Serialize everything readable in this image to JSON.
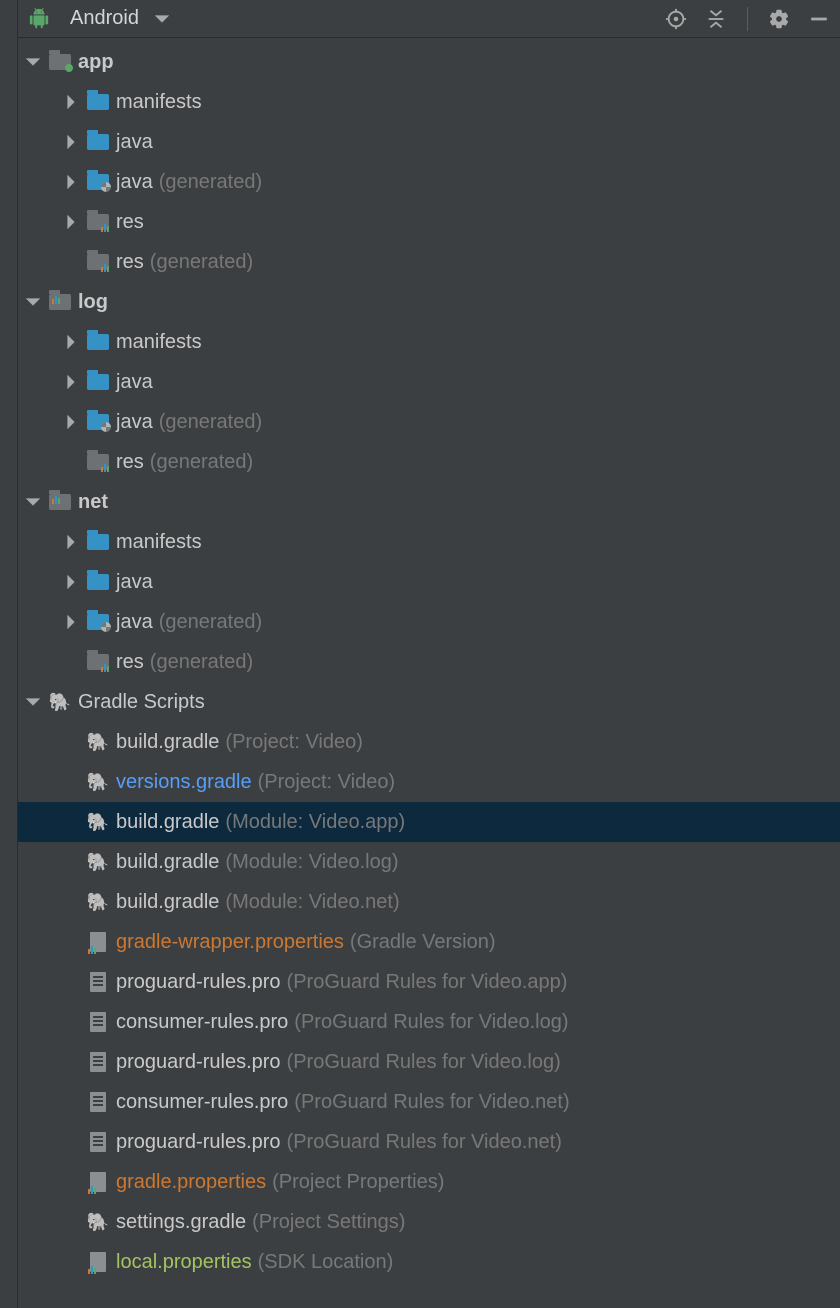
{
  "header": {
    "title": "Android"
  },
  "tree": [
    {
      "indent": 0,
      "arrow": "down",
      "icon": "folder-green",
      "label": "app",
      "bold": true
    },
    {
      "indent": 1,
      "arrow": "right",
      "icon": "folder-blue",
      "label": "manifests"
    },
    {
      "indent": 1,
      "arrow": "right",
      "icon": "folder-blue",
      "label": "java"
    },
    {
      "indent": 1,
      "arrow": "right",
      "icon": "folder-blue-gen",
      "label": "java",
      "suffix": "(generated)"
    },
    {
      "indent": 1,
      "arrow": "right",
      "icon": "folder-grey-res",
      "label": "res"
    },
    {
      "indent": 1,
      "arrow": "none",
      "icon": "folder-grey-res",
      "label": "res",
      "suffix": "(generated)"
    },
    {
      "indent": 0,
      "arrow": "down",
      "icon": "module",
      "label": "log",
      "bold": true
    },
    {
      "indent": 1,
      "arrow": "right",
      "icon": "folder-blue",
      "label": "manifests"
    },
    {
      "indent": 1,
      "arrow": "right",
      "icon": "folder-blue",
      "label": "java"
    },
    {
      "indent": 1,
      "arrow": "right",
      "icon": "folder-blue-gen",
      "label": "java",
      "suffix": "(generated)"
    },
    {
      "indent": 1,
      "arrow": "none",
      "icon": "folder-grey-res",
      "label": "res",
      "suffix": "(generated)"
    },
    {
      "indent": 0,
      "arrow": "down",
      "icon": "module",
      "label": "net",
      "bold": true
    },
    {
      "indent": 1,
      "arrow": "right",
      "icon": "folder-blue",
      "label": "manifests"
    },
    {
      "indent": 1,
      "arrow": "right",
      "icon": "folder-blue",
      "label": "java"
    },
    {
      "indent": 1,
      "arrow": "right",
      "icon": "folder-blue-gen",
      "label": "java",
      "suffix": "(generated)"
    },
    {
      "indent": 1,
      "arrow": "none",
      "icon": "folder-grey-res",
      "label": "res",
      "suffix": "(generated)"
    },
    {
      "indent": 0,
      "arrow": "down",
      "icon": "elephant",
      "label": "Gradle Scripts"
    },
    {
      "indent": 1,
      "arrow": "none",
      "icon": "elephant",
      "label": "build.gradle",
      "suffix": "(Project: Video)"
    },
    {
      "indent": 1,
      "arrow": "none",
      "icon": "elephant-link",
      "label": "versions.gradle",
      "suffix": "(Project: Video)",
      "labelStyle": "link"
    },
    {
      "indent": 1,
      "arrow": "none",
      "icon": "elephant",
      "label": "build.gradle",
      "suffix": "(Module: Video.app)",
      "selected": true
    },
    {
      "indent": 1,
      "arrow": "none",
      "icon": "elephant",
      "label": "build.gradle",
      "suffix": "(Module: Video.log)"
    },
    {
      "indent": 1,
      "arrow": "none",
      "icon": "elephant",
      "label": "build.gradle",
      "suffix": "(Module: Video.net)"
    },
    {
      "indent": 1,
      "arrow": "none",
      "icon": "props",
      "label": "gradle-wrapper.properties",
      "suffix": "(Gradle Version)",
      "labelStyle": "orange"
    },
    {
      "indent": 1,
      "arrow": "none",
      "icon": "doc",
      "label": "proguard-rules.pro",
      "suffix": "(ProGuard Rules for Video.app)"
    },
    {
      "indent": 1,
      "arrow": "none",
      "icon": "doc",
      "label": "consumer-rules.pro",
      "suffix": "(ProGuard Rules for Video.log)"
    },
    {
      "indent": 1,
      "arrow": "none",
      "icon": "doc",
      "label": "proguard-rules.pro",
      "suffix": "(ProGuard Rules for Video.log)"
    },
    {
      "indent": 1,
      "arrow": "none",
      "icon": "doc",
      "label": "consumer-rules.pro",
      "suffix": "(ProGuard Rules for Video.net)"
    },
    {
      "indent": 1,
      "arrow": "none",
      "icon": "doc",
      "label": "proguard-rules.pro",
      "suffix": "(ProGuard Rules for Video.net)"
    },
    {
      "indent": 1,
      "arrow": "none",
      "icon": "props",
      "label": "gradle.properties",
      "suffix": "(Project Properties)",
      "labelStyle": "orange"
    },
    {
      "indent": 1,
      "arrow": "none",
      "icon": "elephant",
      "label": "settings.gradle",
      "suffix": "(Project Settings)"
    },
    {
      "indent": 1,
      "arrow": "none",
      "icon": "props",
      "label": "local.properties",
      "suffix": "(SDK Location)",
      "labelStyle": "olive"
    }
  ]
}
